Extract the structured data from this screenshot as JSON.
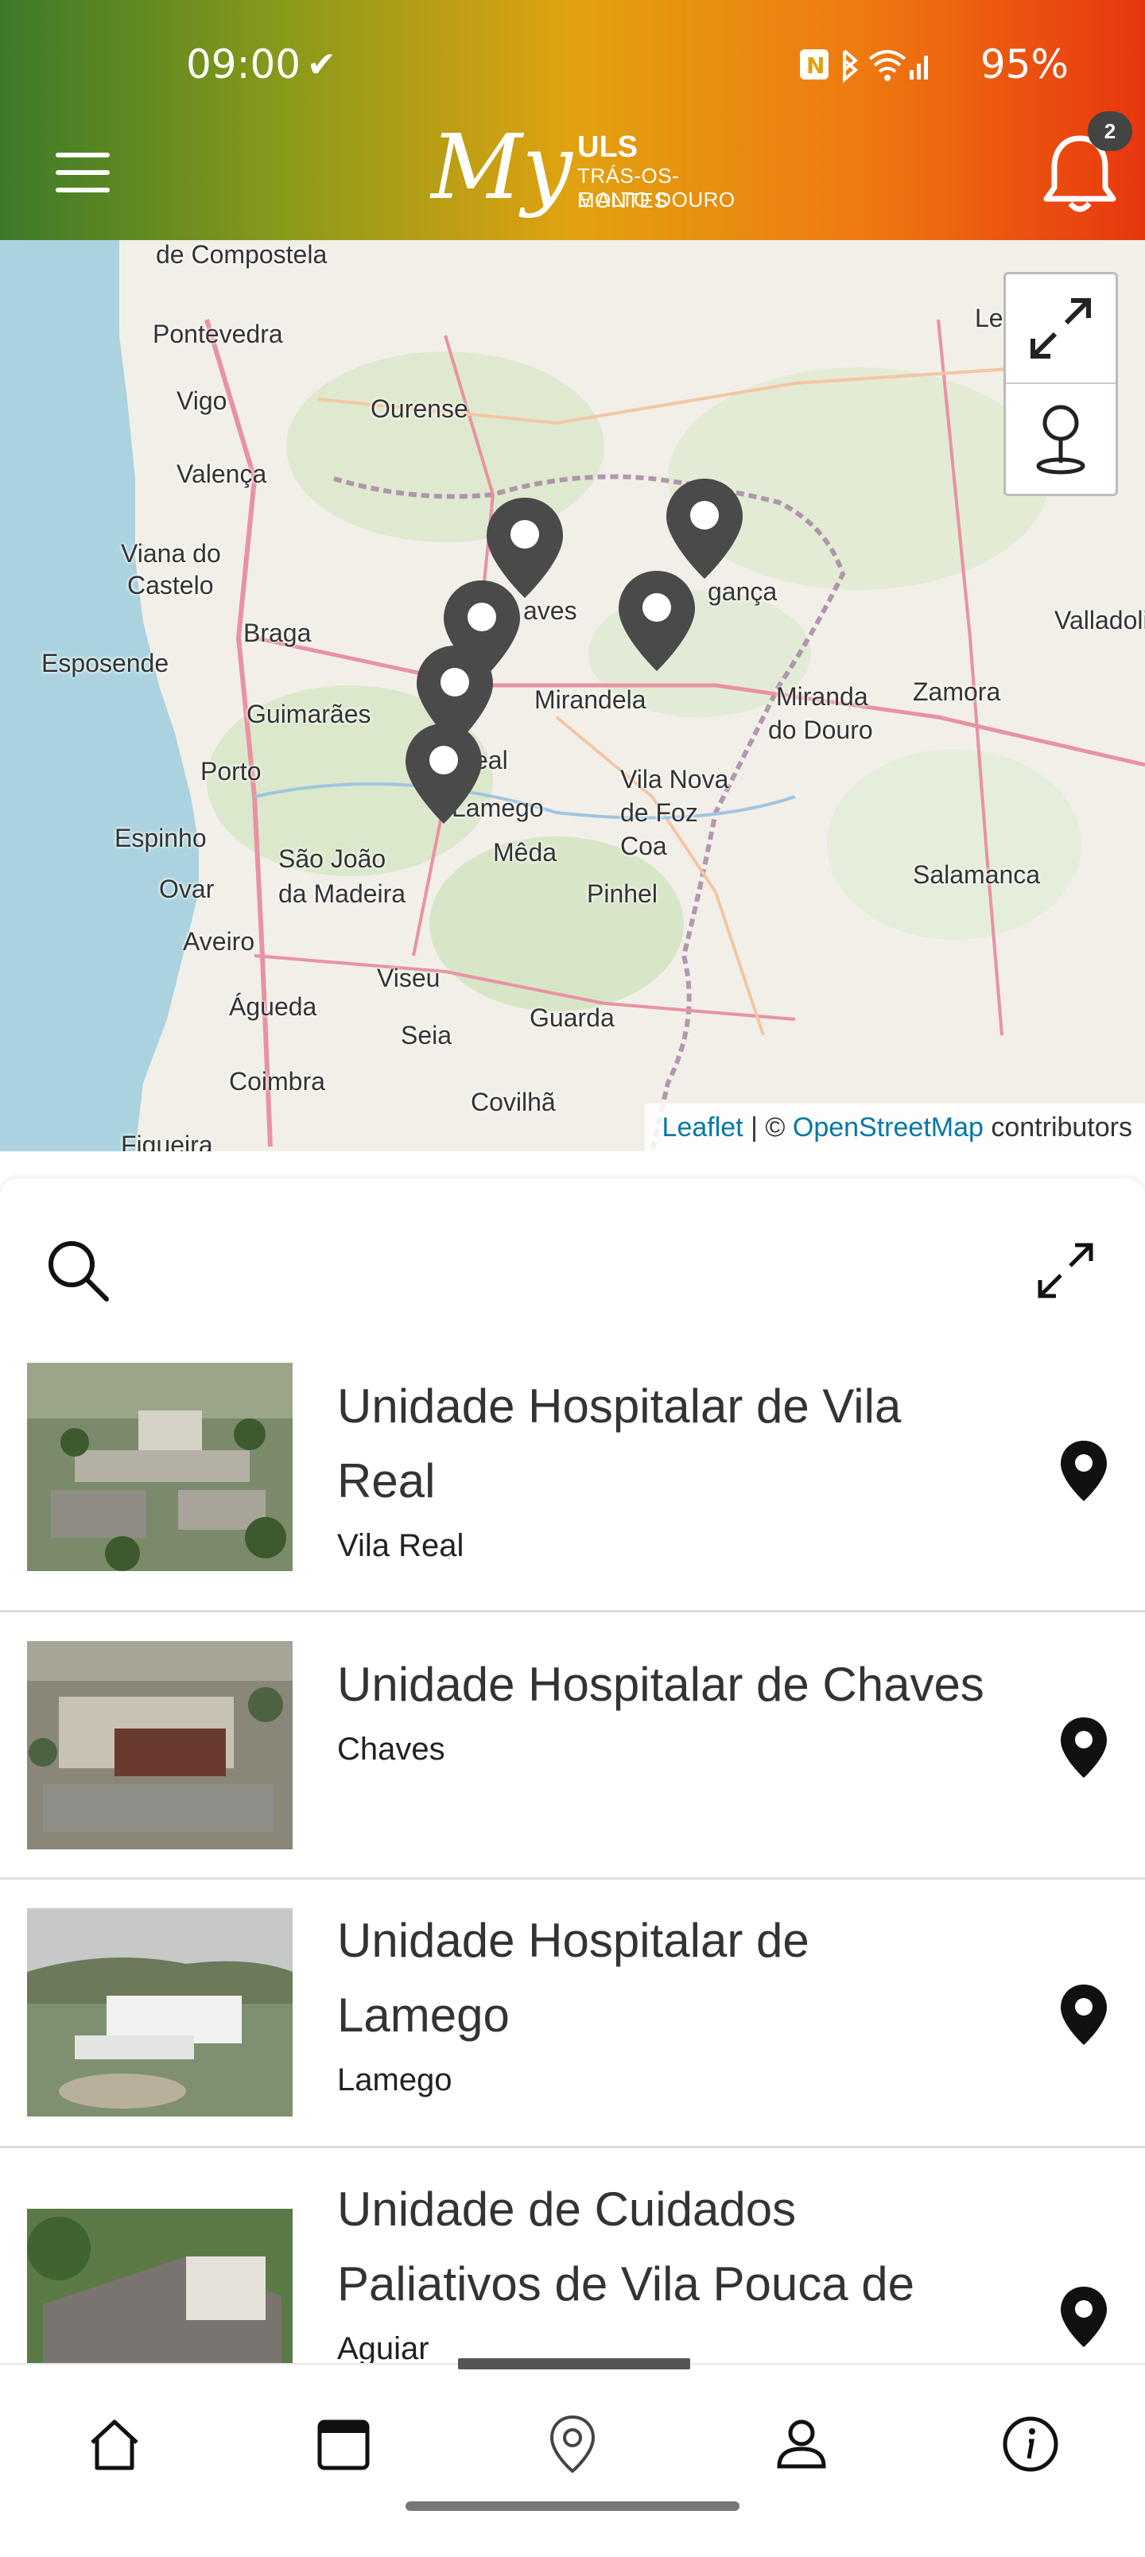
{
  "status": {
    "time": "09:00",
    "battery": "95%"
  },
  "header": {
    "logo_my": "My",
    "logo_uls": "ULS",
    "logo_sub1": "TRÁS-OS-MONTES",
    "logo_sub2": "E ALTO DOURO",
    "notification_count": "2"
  },
  "map": {
    "places": [
      "de Compostela",
      "Pontevedra",
      "Ourense",
      "Vigo",
      "Valença",
      "Viana do",
      "Castelo",
      "Braga",
      "Esposende",
      "Guimarães",
      "Porto",
      "Espinho",
      "Ovar",
      "Aveiro",
      "Águeda",
      "Coimbra",
      "Figueira",
      "São João",
      "da Madeira",
      "Viseu",
      "Seia",
      "Guarda",
      "Covilhã",
      "Mirandela",
      "Miranda",
      "do Douro",
      "Zamora",
      "Salamanca",
      "Vila Nova",
      "de Foz",
      "Coa",
      "Pinhel",
      "Mêda",
      "Lamego",
      "eal",
      "aves",
      "gança",
      "Valladolid",
      "Le"
    ],
    "attribution_link1": "Leaflet",
    "attribution_sep": " | © ",
    "attribution_link2": "OpenStreetMap",
    "attribution_tail": " contributors"
  },
  "list": {
    "items": [
      {
        "title_line1": "Unidade Hospitalar de Vila",
        "title_line2": "Real",
        "subtitle": "Vila Real"
      },
      {
        "title_line1": "Unidade Hospitalar de Chaves",
        "title_line2": "",
        "subtitle": "Chaves"
      },
      {
        "title_line1": "Unidade Hospitalar de",
        "title_line2": "Lamego",
        "subtitle": "Lamego"
      },
      {
        "title_line1": "Unidade de Cuidados",
        "title_line2": "Paliativos de Vila Pouca de",
        "subtitle": "Aguiar"
      }
    ]
  },
  "nav": {
    "items": [
      "home-icon",
      "calendar-icon",
      "location-icon",
      "user-icon",
      "info-icon"
    ]
  },
  "colors": {
    "header_start": "#3c7a2a",
    "header_mid": "#e1a210",
    "header_end": "#e8360f",
    "pin": "#4a4a4a",
    "link": "#0078a8"
  }
}
